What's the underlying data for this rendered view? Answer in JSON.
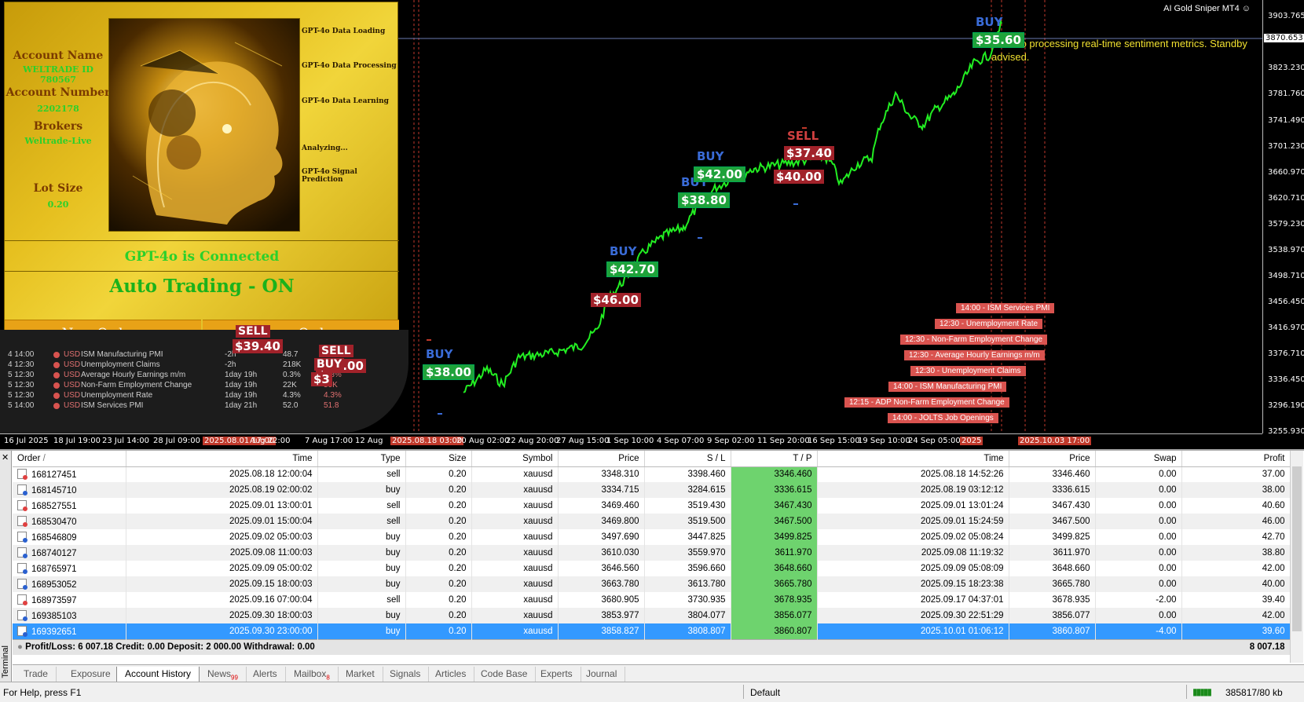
{
  "chart": {
    "title": "AI Gold Sniper MT4",
    "current_price": "3870.653",
    "price_labels": [
      "3903.765",
      "3823.230",
      "3781.760",
      "3741.490",
      "3701.230",
      "3660.970",
      "3620.710",
      "3579.230",
      "3538.970",
      "3498.710",
      "3456.450",
      "3416.970",
      "3376.710",
      "3336.450",
      "3296.190",
      "3255.930"
    ],
    "time_labels": [
      "16 Jul 2025",
      "18 Jul 19:00",
      "23 Jul 14:00",
      "28 Jul 09:00",
      "2025.08.01 17:00",
      "Aug 22:00",
      "7 Aug 17:00",
      "12 Aug",
      "2025.08.18 03:00",
      "20 Aug 02:00",
      "22 Aug 20:00",
      "27 Aug 15:00",
      "1 Sep 10:00",
      "4 Sep 07:00",
      "9 Sep 02:00",
      "11 Sep 20:00",
      "16 Sep 15:00",
      "19 Sep 10:00",
      "24 Sep 05:00",
      "2025",
      "2025.10.03 17:00"
    ],
    "signal_message": "GPT-4o processing real-time sentiment metrics. Standby advised.",
    "trade_labels": [
      {
        "type": "BUY",
        "amount": "$38.00"
      },
      {
        "type": "BUY",
        "amount": "$42.70"
      },
      {
        "type": "",
        "amount": "$46.00"
      },
      {
        "type": "BUY",
        "amount": "$38.80"
      },
      {
        "type": "BUY",
        "amount": "$42.00"
      },
      {
        "type": "SELL",
        "amount": "$37.40"
      },
      {
        "type": "",
        "amount": "$40.00"
      },
      {
        "type": "BUY",
        "amount": "$35.60"
      }
    ],
    "news_events": [
      "14:00 - ISM Services PMI",
      "12:30 - Unemployment Rate",
      "12:30 - Non-Farm Employment Change",
      "12:30 - Average Hourly Earnings m/m",
      "12:30 - Unemployment Claims",
      "14:00 - ISM Manufacturing PMI",
      "12:15 - ADP Non-Farm Employment Change",
      "14:00 - JOLTS Job Openings"
    ]
  },
  "panel": {
    "account_name_label": "Account Name",
    "account_name": "WELTRADE ID 780567",
    "account_number_label": "Account Number",
    "account_number": "2202178",
    "brokers_label": "Brokers",
    "broker": "Weltrade-Live",
    "lot_size_label": "Lot Size",
    "lot_size": "0.20",
    "steps": [
      "GPT-4o Data Loading",
      "GPT-4o Data Processing",
      "GPT-4o Data Learning",
      "Analyzing...",
      "GPT-4o Signal Prediction"
    ],
    "connection": "GPT-4o is Connected",
    "auto_trading": "Auto Trading - ON",
    "new_orders": "New Orders",
    "close_orders": "Close Orders"
  },
  "calendar": {
    "rows": [
      {
        "date": "4 14:00",
        "cur": "USD",
        "event": "ISM Manufacturing PMI",
        "time": "-2h",
        "a": "48.7",
        "b": "",
        "c": ""
      },
      {
        "date": "4 12:30",
        "cur": "USD",
        "event": "Unemployment Claims",
        "time": "-2h",
        "a": "218K",
        "b": "$3",
        "c": ""
      },
      {
        "date": "5 12:30",
        "cur": "USD",
        "event": "Average Hourly Earnings m/m",
        "time": "1day 19h",
        "a": "0.3%",
        "b": "0.3%",
        "c": ""
      },
      {
        "date": "5 12:30",
        "cur": "USD",
        "event": "Non-Farm Employment Change",
        "time": "1day 19h",
        "a": "22K",
        "b": "50K",
        "c": ""
      },
      {
        "date": "5 12:30",
        "cur": "USD",
        "event": "Unemployment Rate",
        "time": "1day 19h",
        "a": "4.3%",
        "b": "4.3%",
        "c": ""
      },
      {
        "date": "5 14:00",
        "cur": "USD",
        "event": "ISM Services PMI",
        "time": "1day 21h",
        "a": "52.0",
        "b": "51.8",
        "c": ""
      }
    ],
    "overlay_labels": [
      {
        "type": "SELL",
        "amount": "$39.40"
      },
      {
        "type": "SELL",
        "amount": "$40.00"
      },
      {
        "type": "BUY",
        "amount": "$3"
      }
    ]
  },
  "terminal": {
    "side_label": "Terminal",
    "headers": [
      "Order",
      "Time",
      "Type",
      "Size",
      "Symbol",
      "Price",
      "S / L",
      "T / P",
      "Time",
      "Price",
      "Swap",
      "Profit"
    ],
    "rows": [
      [
        "168127451",
        "2025.08.18 12:00:04",
        "sell",
        "0.20",
        "xauusd",
        "3348.310",
        "3398.460",
        "3346.460",
        "2025.08.18 14:52:26",
        "3346.460",
        "0.00",
        "37.00"
      ],
      [
        "168145710",
        "2025.08.19 02:00:02",
        "buy",
        "0.20",
        "xauusd",
        "3334.715",
        "3284.615",
        "3336.615",
        "2025.08.19 03:12:12",
        "3336.615",
        "0.00",
        "38.00"
      ],
      [
        "168527551",
        "2025.09.01 13:00:01",
        "sell",
        "0.20",
        "xauusd",
        "3469.460",
        "3519.430",
        "3467.430",
        "2025.09.01 13:01:24",
        "3467.430",
        "0.00",
        "40.60"
      ],
      [
        "168530470",
        "2025.09.01 15:00:04",
        "sell",
        "0.20",
        "xauusd",
        "3469.800",
        "3519.500",
        "3467.500",
        "2025.09.01 15:24:59",
        "3467.500",
        "0.00",
        "46.00"
      ],
      [
        "168546809",
        "2025.09.02 05:00:03",
        "buy",
        "0.20",
        "xauusd",
        "3497.690",
        "3447.825",
        "3499.825",
        "2025.09.02 05:08:24",
        "3499.825",
        "0.00",
        "42.70"
      ],
      [
        "168740127",
        "2025.09.08 11:00:03",
        "buy",
        "0.20",
        "xauusd",
        "3610.030",
        "3559.970",
        "3611.970",
        "2025.09.08 11:19:32",
        "3611.970",
        "0.00",
        "38.80"
      ],
      [
        "168765971",
        "2025.09.09 05:00:02",
        "buy",
        "0.20",
        "xauusd",
        "3646.560",
        "3596.660",
        "3648.660",
        "2025.09.09 05:08:09",
        "3648.660",
        "0.00",
        "42.00"
      ],
      [
        "168953052",
        "2025.09.15 18:00:03",
        "buy",
        "0.20",
        "xauusd",
        "3663.780",
        "3613.780",
        "3665.780",
        "2025.09.15 18:23:38",
        "3665.780",
        "0.00",
        "40.00"
      ],
      [
        "168973597",
        "2025.09.16 07:00:04",
        "sell",
        "0.20",
        "xauusd",
        "3680.905",
        "3730.935",
        "3678.935",
        "2025.09.17 04:37:01",
        "3678.935",
        "-2.00",
        "39.40"
      ],
      [
        "169385103",
        "2025.09.30 18:00:03",
        "buy",
        "0.20",
        "xauusd",
        "3853.977",
        "3804.077",
        "3856.077",
        "2025.09.30 22:51:29",
        "3856.077",
        "0.00",
        "42.00"
      ],
      [
        "169392651",
        "2025.09.30 23:00:00",
        "buy",
        "0.20",
        "xauusd",
        "3858.827",
        "3808.807",
        "3860.807",
        "2025.10.01 01:06:12",
        "3860.807",
        "-4.00",
        "39.60"
      ]
    ],
    "summary_text": "Profit/Loss: 6 007.18  Credit: 0.00  Deposit: 2 000.00  Withdrawal: 0.00",
    "summary_total": "8 007.18",
    "tabs": [
      {
        "label": "Trade",
        "badge": ""
      },
      {
        "label": "Exposure",
        "badge": ""
      },
      {
        "label": "Account History",
        "badge": ""
      },
      {
        "label": "News",
        "badge": "99"
      },
      {
        "label": "Alerts",
        "badge": ""
      },
      {
        "label": "Mailbox",
        "badge": "8"
      },
      {
        "label": "Market",
        "badge": ""
      },
      {
        "label": "Signals",
        "badge": ""
      },
      {
        "label": "Articles",
        "badge": ""
      },
      {
        "label": "Code Base",
        "badge": ""
      },
      {
        "label": "Experts",
        "badge": ""
      },
      {
        "label": "Journal",
        "badge": ""
      }
    ]
  },
  "status": {
    "help": "For Help, press F1",
    "profile": "Default",
    "traffic": "385817/80 kb"
  }
}
